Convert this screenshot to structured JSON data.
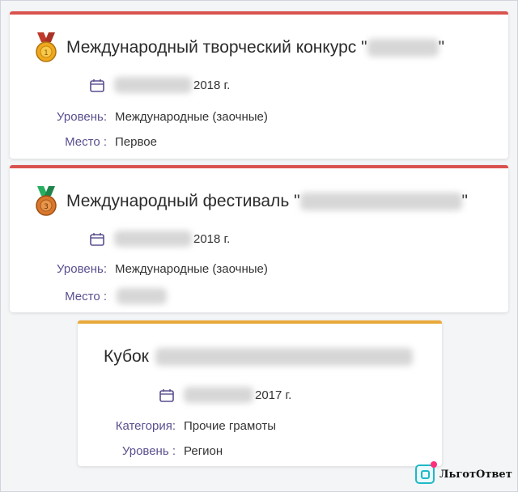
{
  "colors": {
    "card1_accent": "#d9534f",
    "card2_accent": "#d9534f",
    "card3_accent": "#e9a93a",
    "label_color": "#5a4f8f",
    "logo_accent": "#20b8c6"
  },
  "cards": [
    {
      "icon": "gold-medal-icon",
      "title": "Международный творческий конкурс \"",
      "title_close": "\"",
      "date_suffix": "2018 г.",
      "fields": [
        {
          "label": "Уровень:",
          "value": "Международные (заочные)"
        },
        {
          "label": "Место :",
          "value": "Первое"
        }
      ]
    },
    {
      "icon": "bronze-medal-icon",
      "title": "Международный фестиваль \"",
      "title_close": "\"",
      "date_suffix": "2018 г.",
      "fields": [
        {
          "label": "Уровень:",
          "value": "Международные (заочные)"
        },
        {
          "label": "Место :",
          "value": ""
        }
      ]
    },
    {
      "title": "Кубок",
      "date_suffix": "2017 г.",
      "fields": [
        {
          "label": "Категория:",
          "value": "Прочие грамоты"
        },
        {
          "label": "Уровень :",
          "value": "Регион"
        }
      ]
    }
  ],
  "watermark": {
    "text": "ЛьготОтвет"
  }
}
